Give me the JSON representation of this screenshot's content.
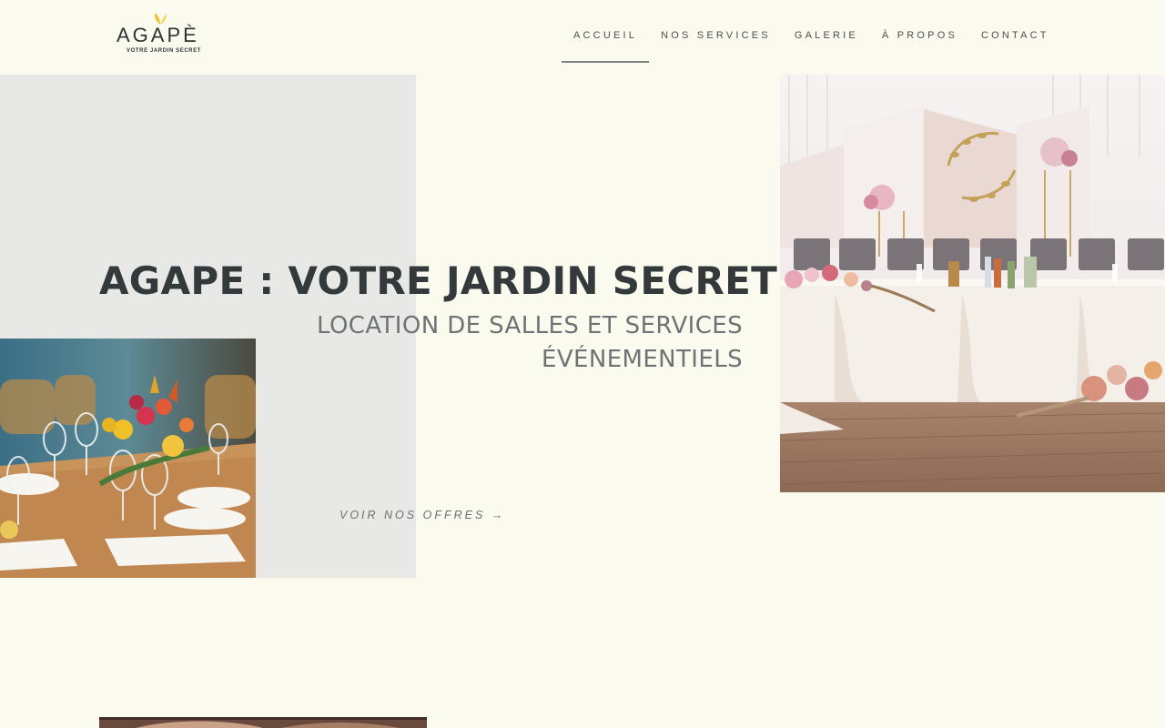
{
  "header": {
    "logo": {
      "wordmark": "AGAPÈ",
      "tagline": "VOTRE JARDIN SECRET",
      "leaf_icon": "leaf-icon",
      "leaf_color": "#e9c93a"
    },
    "nav": {
      "items": [
        {
          "label": "ACCUEIL",
          "active": true
        },
        {
          "label": "NOS SERVICES",
          "active": false
        },
        {
          "label": "GALERIE",
          "active": false
        },
        {
          "label": "À PROPOS",
          "active": false
        },
        {
          "label": "CONTACT",
          "active": false
        }
      ]
    }
  },
  "hero": {
    "title": "AGAPE : VOTRE JARDIN SECRET",
    "subtitle_line1": "LOCATION DE SALLES ET SERVICES",
    "subtitle_line2": "ÉVÉNEMENTIELS",
    "cta_label": "VOIR NOS OFFRES →"
  },
  "colors": {
    "background": "#fbfaee",
    "panel": "#e8e9e7",
    "title": "#343a3b",
    "subtitle": "#6e7374",
    "nav_underline": "#7c8183"
  },
  "images": {
    "left_photo": "table-setting-with-flowers-photo",
    "right_photo": "wedding-head-table-photo",
    "bottom_photo": "venue-interior-photo"
  }
}
